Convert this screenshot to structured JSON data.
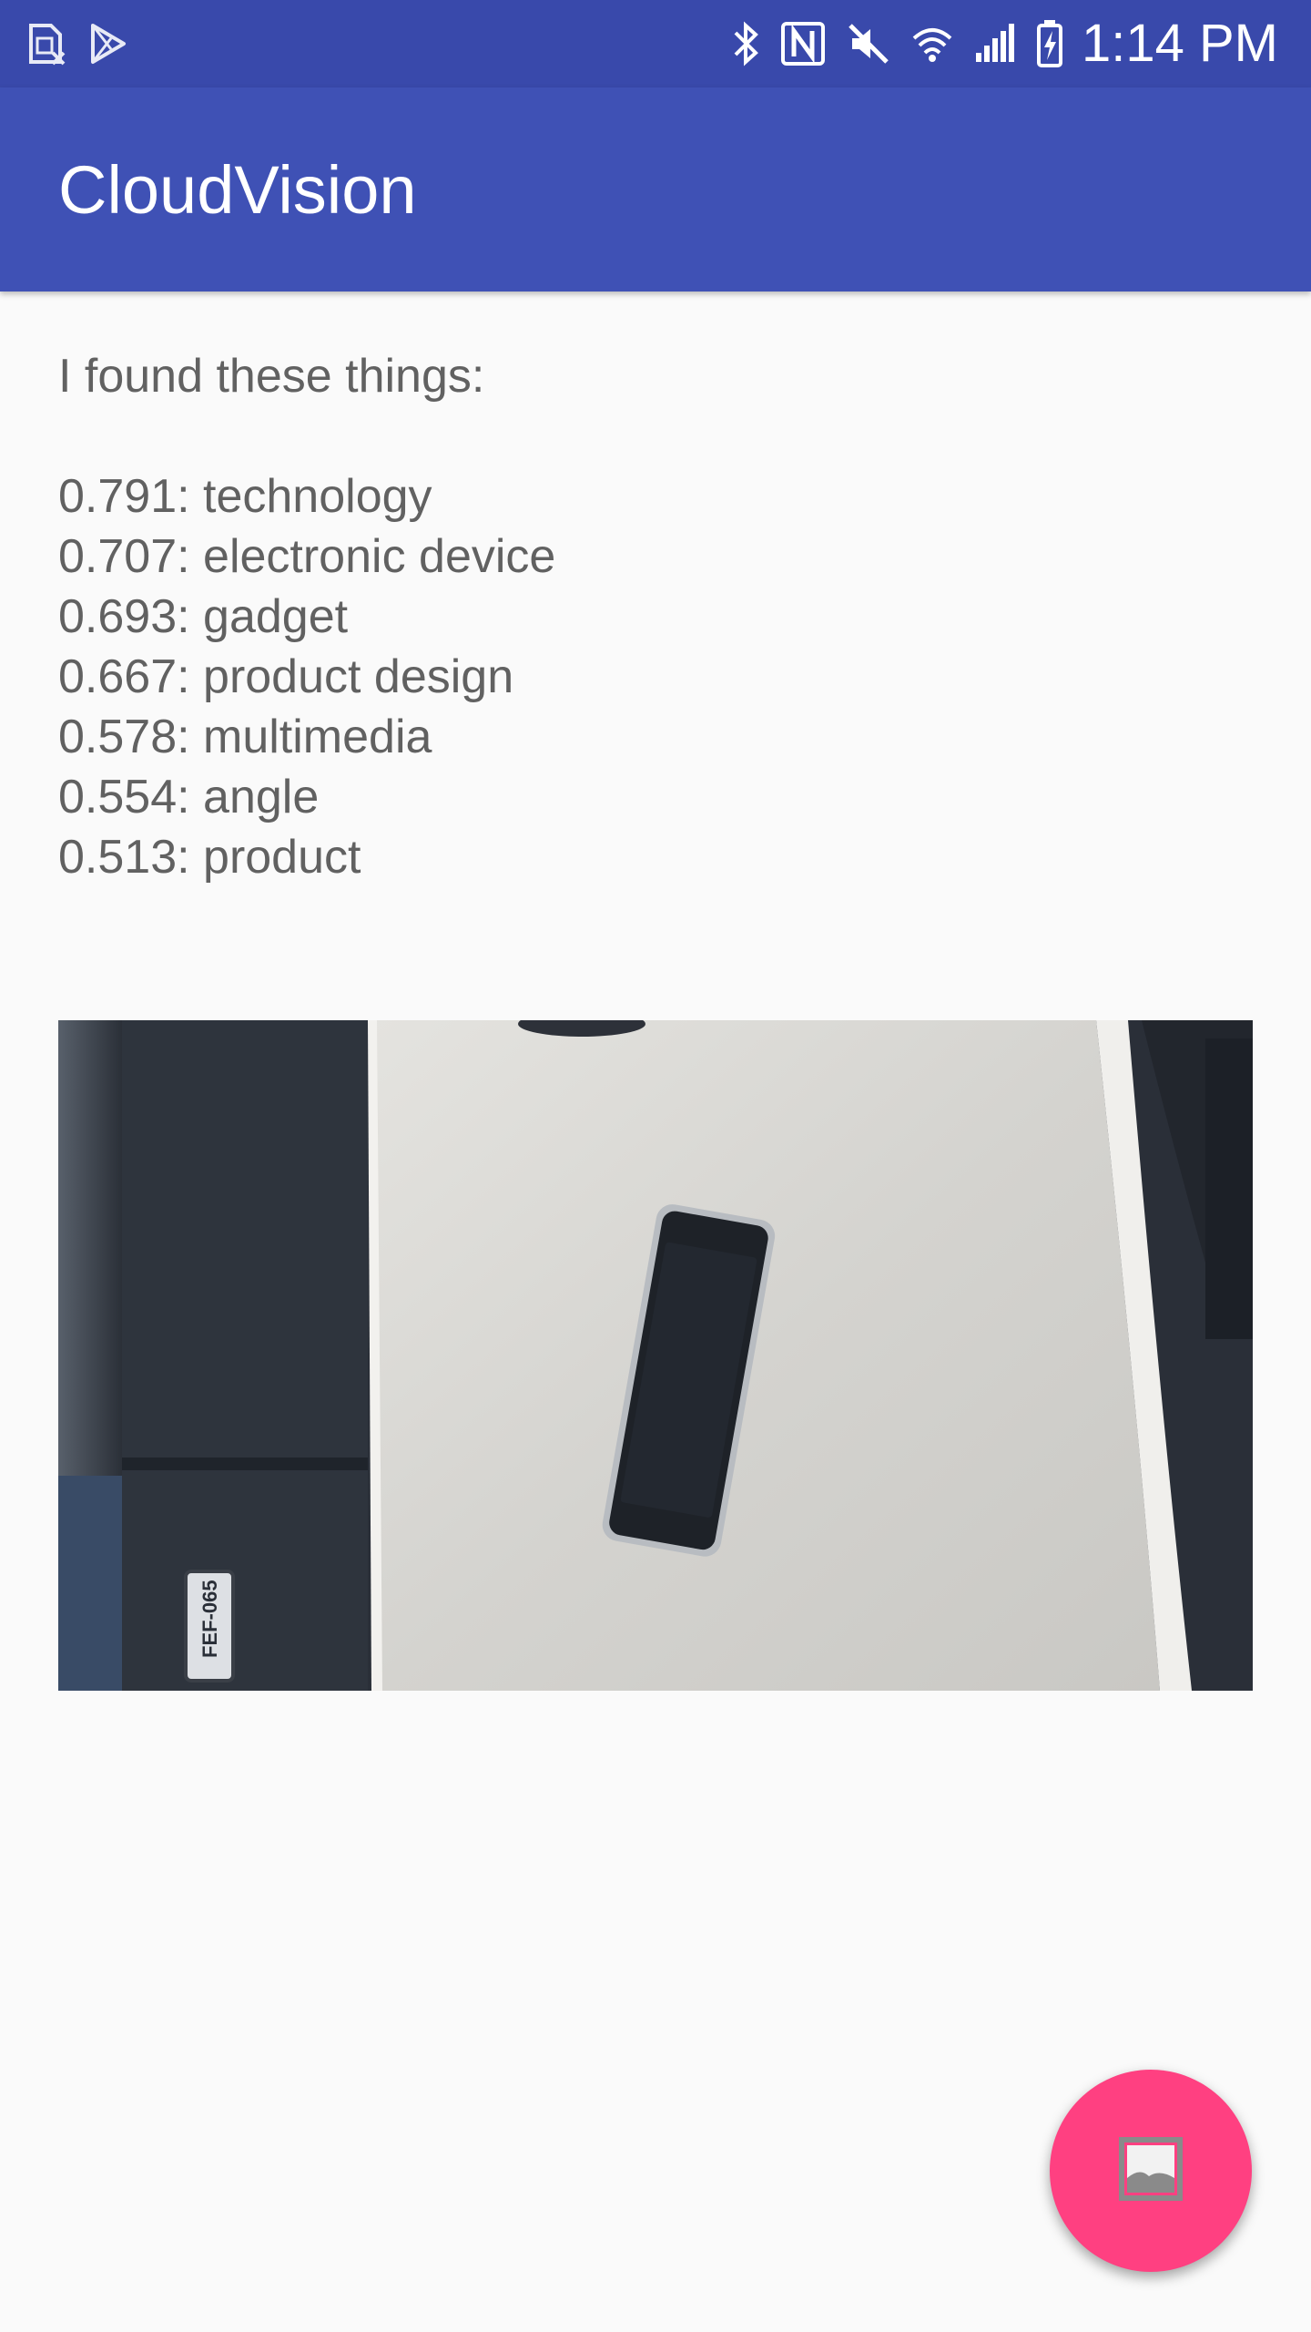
{
  "status_bar": {
    "time": "1:14 PM",
    "left_icons": [
      "no-sim-icon",
      "play-store-icon"
    ],
    "right_icons": [
      "bluetooth-icon",
      "nfc-icon",
      "mute-icon",
      "wifi-icon",
      "signal-icon",
      "battery-charging-icon"
    ]
  },
  "app_bar": {
    "title": "CloudVision"
  },
  "main": {
    "intro": "I found these things:",
    "labels": [
      "0.791: technology",
      "0.707: electronic device",
      "0.693: gadget",
      "0.667: product design",
      "0.578: multimedia",
      "0.554: angle",
      "0.513: product"
    ],
    "photo": {
      "plate_text": "FEF-065"
    }
  },
  "fab": {
    "icon": "image-icon"
  },
  "colors": {
    "status_bar": "#3949ab",
    "app_bar": "#3f51b5",
    "fab": "#ff4081",
    "background": "#fafafa",
    "text": "#616161"
  }
}
